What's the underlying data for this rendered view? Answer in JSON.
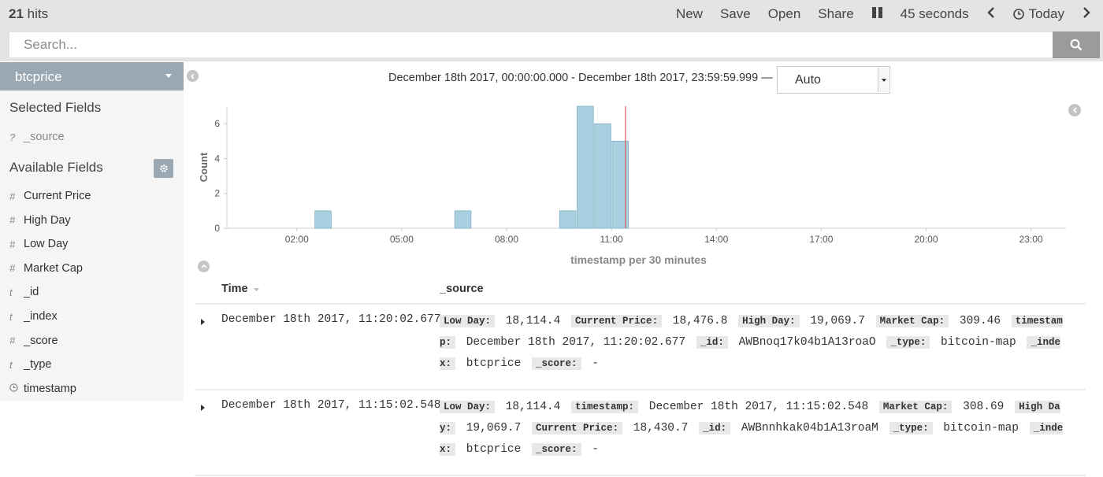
{
  "header": {
    "hits_count": "21",
    "hits_label": "hits",
    "nav": [
      "New",
      "Save",
      "Open",
      "Share"
    ],
    "refresh_interval": "45 seconds",
    "time_label": "Today"
  },
  "search": {
    "placeholder": "Search..."
  },
  "sidebar": {
    "index_pattern": "btcprice",
    "selected_title": "Selected Fields",
    "selected_fields": [
      {
        "type": "?",
        "name": "_source"
      }
    ],
    "available_title": "Available Fields",
    "available_fields": [
      {
        "type": "#",
        "name": "Current Price"
      },
      {
        "type": "#",
        "name": "High Day"
      },
      {
        "type": "#",
        "name": "Low Day"
      },
      {
        "type": "#",
        "name": "Market Cap"
      },
      {
        "type": "t",
        "name": "_id"
      },
      {
        "type": "t",
        "name": "_index"
      },
      {
        "type": "#",
        "name": "_score"
      },
      {
        "type": "t",
        "name": "_type"
      },
      {
        "type": "clock",
        "name": "timestamp"
      }
    ]
  },
  "time_range": {
    "text": "December 18th 2017, 00:00:00.000 - December 18th 2017, 23:59:59.999 —",
    "interval": "Auto"
  },
  "chart_data": {
    "type": "bar",
    "xlabel": "timestamp per 30 minutes",
    "ylabel": "Count",
    "x_unit": "hours since 00:00",
    "x_ticks": [
      "02:00",
      "05:00",
      "08:00",
      "11:00",
      "14:00",
      "17:00",
      "20:00",
      "23:00"
    ],
    "y_ticks": [
      0,
      2,
      4,
      6
    ],
    "ylim": [
      0,
      7
    ],
    "xlim": [
      0,
      24
    ],
    "bars": [
      {
        "x": 2.5,
        "value": 1
      },
      {
        "x": 6.5,
        "value": 1
      },
      {
        "x": 9.5,
        "value": 1
      },
      {
        "x": 10.0,
        "value": 7
      },
      {
        "x": 10.5,
        "value": 6
      },
      {
        "x": 11.0,
        "value": 5
      }
    ],
    "marker_x": 11.4,
    "colors": {
      "bar": "#a8d0e0",
      "bar_stroke": "#7fb0c4",
      "marker": "#e05a5a"
    }
  },
  "table": {
    "col_time": "Time",
    "col_source": "_source",
    "rows": [
      {
        "time": "December 18th 2017, 11:20:02.677",
        "fields": [
          [
            "Low Day:",
            "18,114.4"
          ],
          [
            "Current Price:",
            "18,476.8"
          ],
          [
            "High Day:",
            "19,069.7"
          ],
          [
            "Market Cap:",
            "309.46"
          ],
          [
            "timestamp:",
            "December 18th 2017, 11:20:02.677"
          ],
          [
            "_id:",
            "AWBnoq17k04b1A13roaO"
          ],
          [
            "_type:",
            "bitcoin-map"
          ],
          [
            "_index:",
            "btcprice"
          ],
          [
            "_score:",
            "-"
          ]
        ]
      },
      {
        "time": "December 18th 2017, 11:15:02.548",
        "fields": [
          [
            "Low Day:",
            "18,114.4"
          ],
          [
            "timestamp:",
            "December 18th 2017, 11:15:02.548"
          ],
          [
            "Market Cap:",
            "308.69"
          ],
          [
            "High Day:",
            "19,069.7"
          ],
          [
            "Current Price:",
            "18,430.7"
          ],
          [
            "_id:",
            "AWBnnhkak04b1A13roaM"
          ],
          [
            "_type:",
            "bitcoin-map"
          ],
          [
            "_index:",
            "btcprice"
          ],
          [
            "_score:",
            "-"
          ]
        ]
      }
    ]
  }
}
